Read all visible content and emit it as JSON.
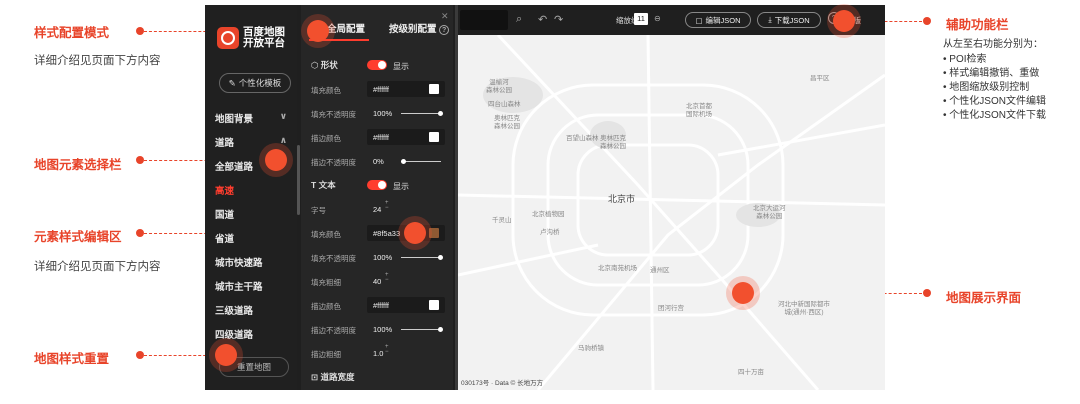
{
  "callouts": {
    "style_mode": "样式配置模式",
    "style_mode_sub": "详细介绍见页面下方内容",
    "element_select": "地图元素选择栏",
    "element_edit": "元素样式编辑区",
    "element_edit_sub": "详细介绍见页面下方内容",
    "style_reset": "地图样式重置",
    "aux_bar": "辅助功能栏",
    "map_display": "地图展示界面"
  },
  "aux_desc": {
    "intro": "从左至右功能分别为：",
    "items": [
      "POI检索",
      "样式编辑撤销、重做",
      "地图缩放级别控制",
      "个性化JSON文件编辑",
      "个性化JSON文件下载"
    ]
  },
  "sidebar": {
    "logo_line1": "百度地图",
    "logo_line2": "开放平台",
    "template_button": "个性化模板",
    "groups": [
      {
        "label": "地图背景",
        "chevron": "∨"
      },
      {
        "label": "道路",
        "chevron": "∧"
      }
    ],
    "items": [
      "全部道路",
      "高速",
      "国道",
      "省道",
      "城市快速路",
      "城市主干路",
      "三级道路",
      "四级道路"
    ],
    "active_item": "高速",
    "reset_button": "重置地图"
  },
  "editor": {
    "tab_global": "全局配置",
    "tab_level": "按级别配置",
    "shape_label": "形状",
    "show_label": "显示",
    "text_label": "文本",
    "shape_rows": [
      {
        "label": "填充颜色",
        "value": "#ffffff"
      },
      {
        "label": "填充不透明度",
        "value": "100%"
      },
      {
        "label": "描边颜色",
        "value": "#ffffff"
      },
      {
        "label": "描边不透明度",
        "value": "0%"
      }
    ],
    "text_rows": [
      {
        "label": "字号",
        "value": "24"
      },
      {
        "label": "填充颜色",
        "value": "#8f5a33"
      },
      {
        "label": "填充不透明度",
        "value": "100%"
      },
      {
        "label": "填充粗细",
        "value": "40"
      },
      {
        "label": "描边颜色",
        "value": "#ffffff"
      },
      {
        "label": "描边不透明度",
        "value": "100%"
      },
      {
        "label": "描边粗细",
        "value": "1.0"
      }
    ],
    "road_width_label": "道路宽度",
    "text_color_swatch": "#8f5a33"
  },
  "toolbar": {
    "zoom_label": "缩放级别",
    "zoom_value": "11",
    "edit_json": "编辑JSON",
    "download_json": "下载JSON",
    "old_version": "旧版"
  },
  "map": {
    "city": "北京市",
    "labels": [
      "昌平区",
      "温榆河\n森林公园",
      "四台山森林",
      "奥林匹克\n森林公园",
      "北京首都\n国际机场",
      "百望山森林",
      "奥林匹克\n森林公园",
      "千灵山",
      "北京植物园",
      "卢沟桥",
      "北京南苑机场",
      "通州区",
      "北京大运河\n森林公园",
      "团河行宫",
      "河北中新国际都市\n城(通州·西区)",
      "马驹桥镇",
      "四十万亩"
    ],
    "footer": "030173号 · Data © 长地万方"
  }
}
